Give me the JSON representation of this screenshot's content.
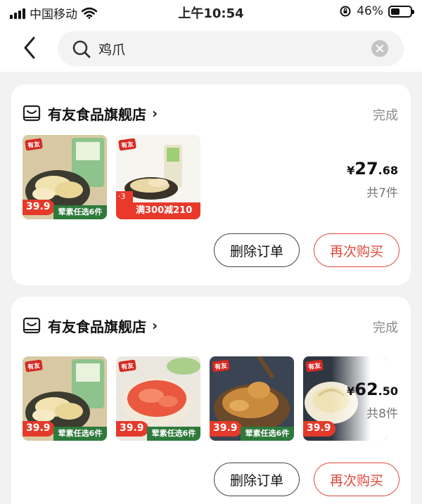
{
  "status_bar": {
    "carrier": "中国移动",
    "time": "上午10:54",
    "battery_percent": "46%",
    "battery_level": 0.46,
    "icons": [
      "signal-icon",
      "wifi-icon",
      "orientation-lock-icon",
      "battery-icon"
    ]
  },
  "search": {
    "query": "鸡爪",
    "icons": [
      "back-arrow-icon",
      "search-icon",
      "clear-icon"
    ]
  },
  "orders": [
    {
      "store_name": "有友食品旗舰店",
      "status": "完成",
      "price_symbol": "¥",
      "price_int": "27",
      "price_dec": ".68",
      "item_count": "共7件",
      "delete_label": "删除订单",
      "rebuy_label": "再次购买",
      "products": [
        {
          "brand": "有友",
          "price_tag": "39.9",
          "promo": "荤素任选6件"
        },
        {
          "brand": "有友",
          "count": "3",
          "promo": "满300减210"
        }
      ]
    },
    {
      "store_name": "有友食品旗舰店",
      "status": "完成",
      "price_symbol": "¥",
      "price_int": "62",
      "price_dec": ".50",
      "item_count": "共8件",
      "delete_label": "删除订单",
      "rebuy_label": "再次购买",
      "products": [
        {
          "brand": "有友",
          "price_tag": "39.9",
          "promo": "荤素任选6件"
        },
        {
          "brand": "有友",
          "price_tag": "39.9",
          "promo": "荤素任选6件"
        },
        {
          "brand": "有友",
          "price_tag": "39.9",
          "promo": "荤素任选6件"
        },
        {
          "brand": "有友",
          "price_tag": "39.9",
          "promo": ""
        }
      ]
    }
  ],
  "colors": {
    "accent": "#e0493d",
    "promo_green": "#2e7a3c",
    "sale_red": "#e8392b",
    "background": "#f2f2f2"
  }
}
